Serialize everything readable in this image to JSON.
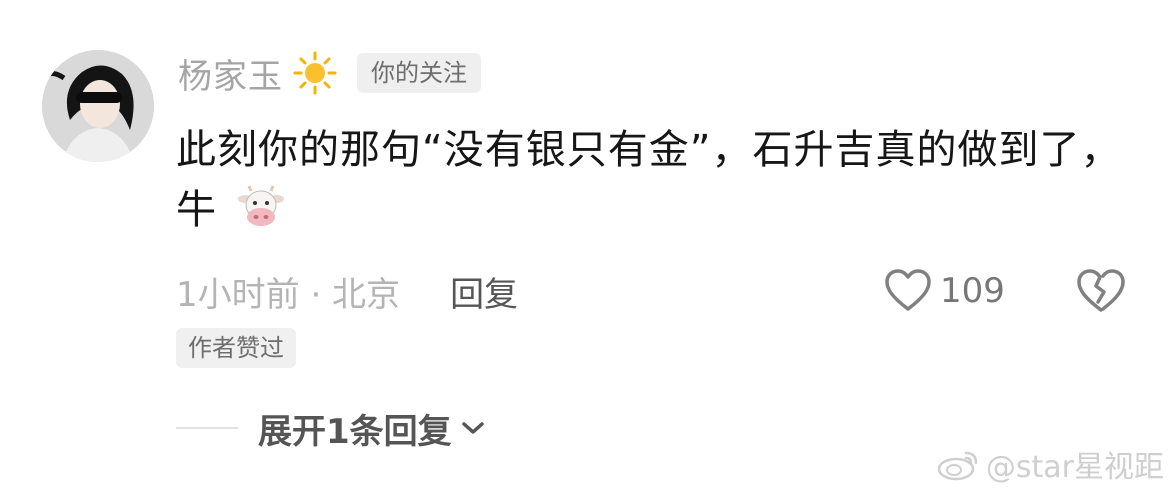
{
  "comment": {
    "username": "杨家玉",
    "follow_badge": "你的关注",
    "text": "此刻你的那句“没有银只有金”，石升吉真的做到了，牛",
    "time_location": "1小时前 · 北京",
    "reply_label": "回复",
    "like_count": "109",
    "author_badge": "作者赞过",
    "expand_replies": "展开1条回复",
    "icons": {
      "title_emoji": "sun-icon",
      "text_emoji": "cow-face-icon",
      "like": "heart-icon",
      "dislike": "broken-heart-icon",
      "expand": "chevron-down-icon"
    }
  },
  "watermark": {
    "text": "@star星视距",
    "icon": "weibo-icon"
  },
  "colors": {
    "username": "#a5a5a5",
    "content": "#161616",
    "meta": "#b4b4b4",
    "badge_bg": "#efefef"
  }
}
